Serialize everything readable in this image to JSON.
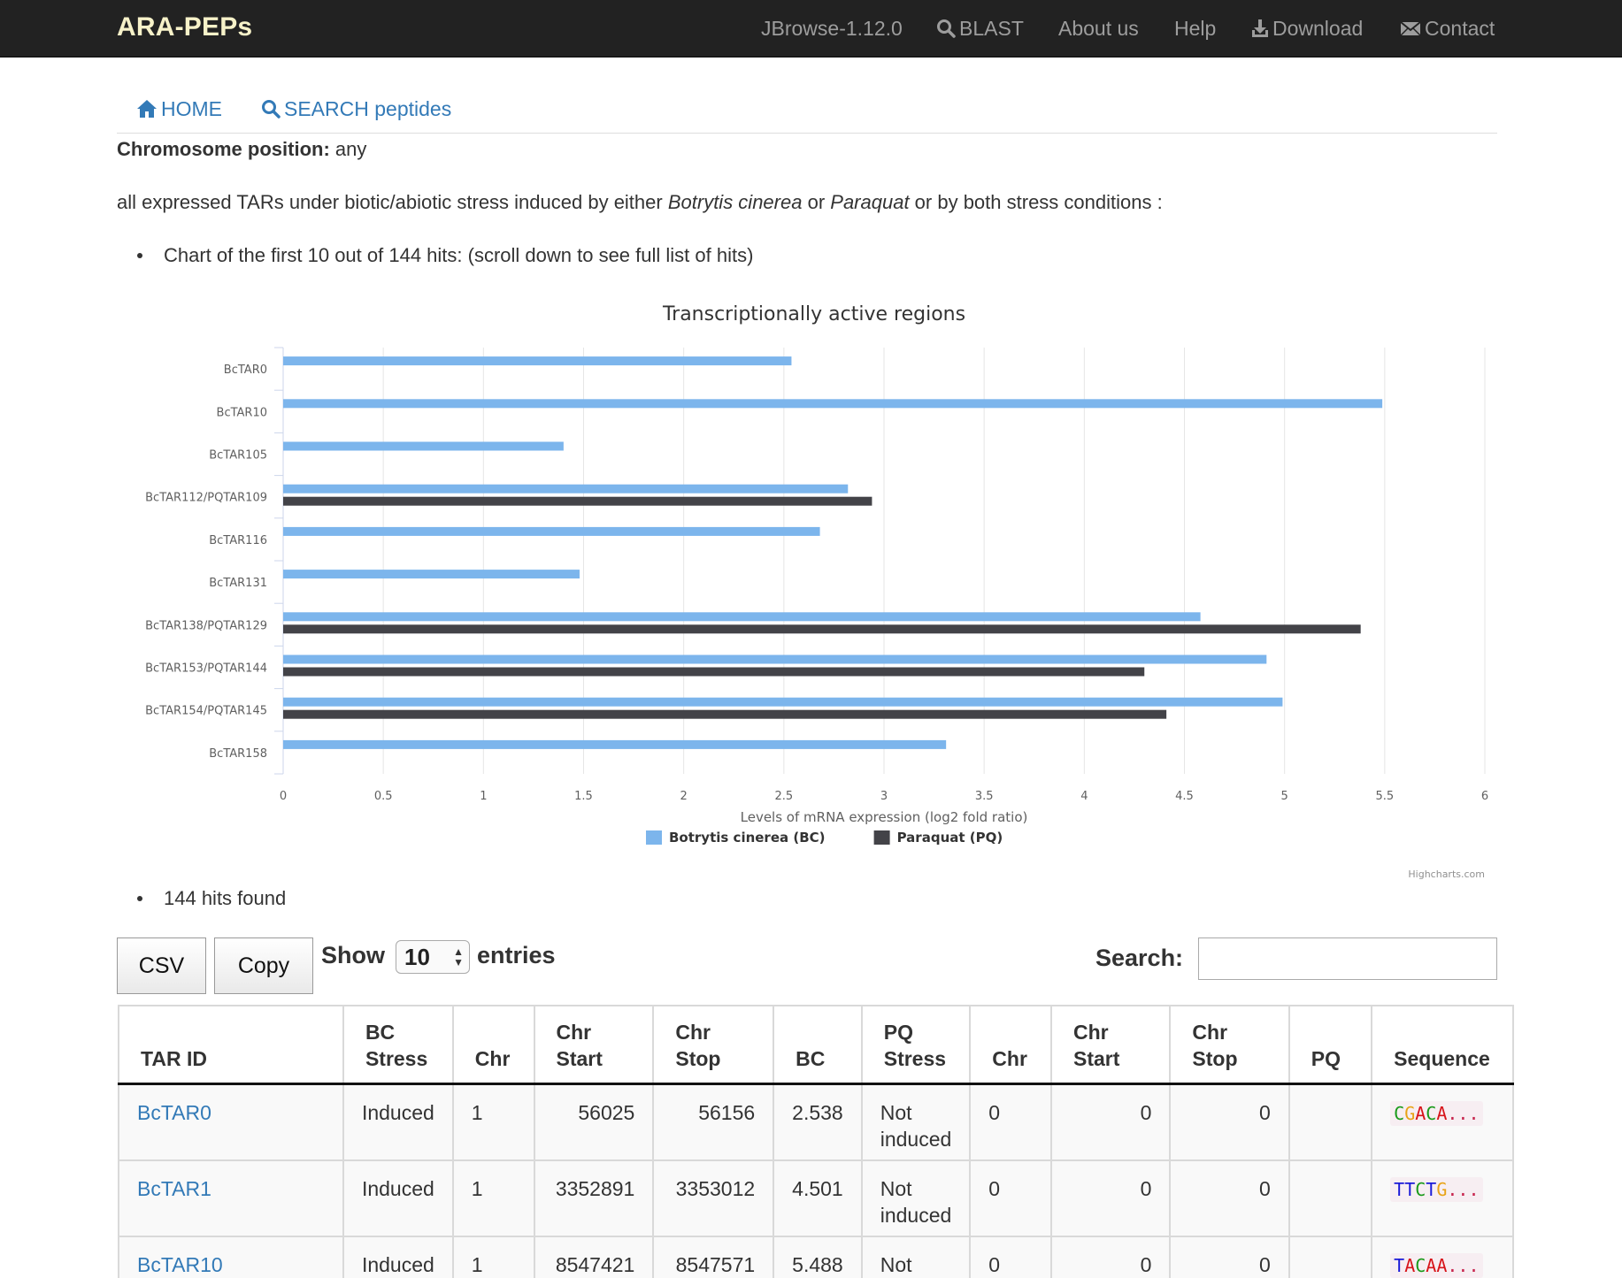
{
  "navbar": {
    "brand": "ARA-PEPs",
    "items": [
      {
        "label": "JBrowse-1.12.0",
        "icon": ""
      },
      {
        "label": "BLAST",
        "icon": "search-icon"
      },
      {
        "label": "About us",
        "icon": ""
      },
      {
        "label": "Help",
        "icon": ""
      },
      {
        "label": "Download",
        "icon": "download-icon"
      },
      {
        "label": "Contact",
        "icon": "envelope-icon"
      }
    ]
  },
  "subnav": {
    "home": "HOME",
    "search": "SEARCH peptides"
  },
  "chromosome_position": {
    "label": "Chromosome position:",
    "value": "any"
  },
  "description": {
    "prefix": "all expressed TARs under biotic/abiotic stress induced by either ",
    "organism": "Botrytis cinerea",
    "mid": " or ",
    "chemical": "Paraquat",
    "suffix": " or by both stress conditions :"
  },
  "bullets": {
    "chart_note": "Chart of the first 10 out of 144 hits: (scroll down to see full list of hits)",
    "hits_found": "144 hits found"
  },
  "chart_data": {
    "type": "bar",
    "orientation": "horizontal",
    "title": "Transcriptionally active regions",
    "xlabel": "Levels of mRNA expression (log2 fold ratio)",
    "categories": [
      "BcTAR0",
      "BcTAR10",
      "BcTAR105",
      "BcTAR112/PQTAR109",
      "BcTAR116",
      "BcTAR131",
      "BcTAR138/PQTAR129",
      "BcTAR153/PQTAR144",
      "BcTAR154/PQTAR145",
      "BcTAR158"
    ],
    "series": [
      {
        "name": "Botrytis cinerea (BC)",
        "color": "#7cb5ec",
        "values": [
          2.538,
          5.488,
          1.4,
          2.82,
          2.68,
          1.48,
          4.58,
          4.91,
          4.99,
          3.31
        ]
      },
      {
        "name": "Paraquat (PQ)",
        "color": "#434348",
        "values": [
          null,
          null,
          null,
          2.94,
          null,
          null,
          5.38,
          4.3,
          4.41,
          null
        ]
      }
    ],
    "xlim": [
      0,
      6
    ],
    "ticks": [
      "0",
      "0.5",
      "1",
      "1.5",
      "2",
      "2.5",
      "3",
      "3.5",
      "4",
      "4.5",
      "5",
      "5.5",
      "6"
    ],
    "grid": true,
    "legend_position": "bottom-center",
    "credit": "Highcharts.com"
  },
  "controls": {
    "csv": "CSV",
    "copy": "Copy",
    "show": "Show",
    "entries_value": "10",
    "entries": "entries",
    "search_label": "Search:",
    "search_value": ""
  },
  "table": {
    "headers": [
      {
        "line1": "",
        "line2": "TAR ID"
      },
      {
        "line1": "BC",
        "line2": "Stress"
      },
      {
        "line1": "",
        "line2": "Chr"
      },
      {
        "line1": "Chr",
        "line2": "Start"
      },
      {
        "line1": "Chr",
        "line2": "Stop"
      },
      {
        "line1": "",
        "line2": "BC"
      },
      {
        "line1": "PQ",
        "line2": "Stress"
      },
      {
        "line1": "",
        "line2": "Chr"
      },
      {
        "line1": "Chr",
        "line2": "Start"
      },
      {
        "line1": "Chr",
        "line2": "Stop"
      },
      {
        "line1": "",
        "line2": "PQ"
      },
      {
        "line1": "",
        "line2": "Sequence"
      }
    ],
    "rows": [
      {
        "tar_id": "BcTAR0",
        "bc_stress": "Induced",
        "bc_chr": "1",
        "bc_start": "56025",
        "bc_stop": "56156",
        "bc": "2.538",
        "pq_stress": "Not induced",
        "pq_chr": "0",
        "pq_start": "0",
        "pq_stop": "0",
        "pq": "",
        "sequence": "CGACA",
        "ellipsis": "..."
      },
      {
        "tar_id": "BcTAR1",
        "bc_stress": "Induced",
        "bc_chr": "1",
        "bc_start": "3352891",
        "bc_stop": "3353012",
        "bc": "4.501",
        "pq_stress": "Not induced",
        "pq_chr": "0",
        "pq_start": "0",
        "pq_stop": "0",
        "pq": "",
        "sequence": "TTCTG",
        "ellipsis": "..."
      },
      {
        "tar_id": "BcTAR10",
        "bc_stress": "Induced",
        "bc_chr": "1",
        "bc_start": "8547421",
        "bc_stop": "8547571",
        "bc": "5.488",
        "pq_stress": "Not induced",
        "pq_chr": "0",
        "pq_start": "0",
        "pq_stop": "0",
        "pq": "",
        "sequence": "TACAA",
        "ellipsis": "..."
      }
    ]
  }
}
